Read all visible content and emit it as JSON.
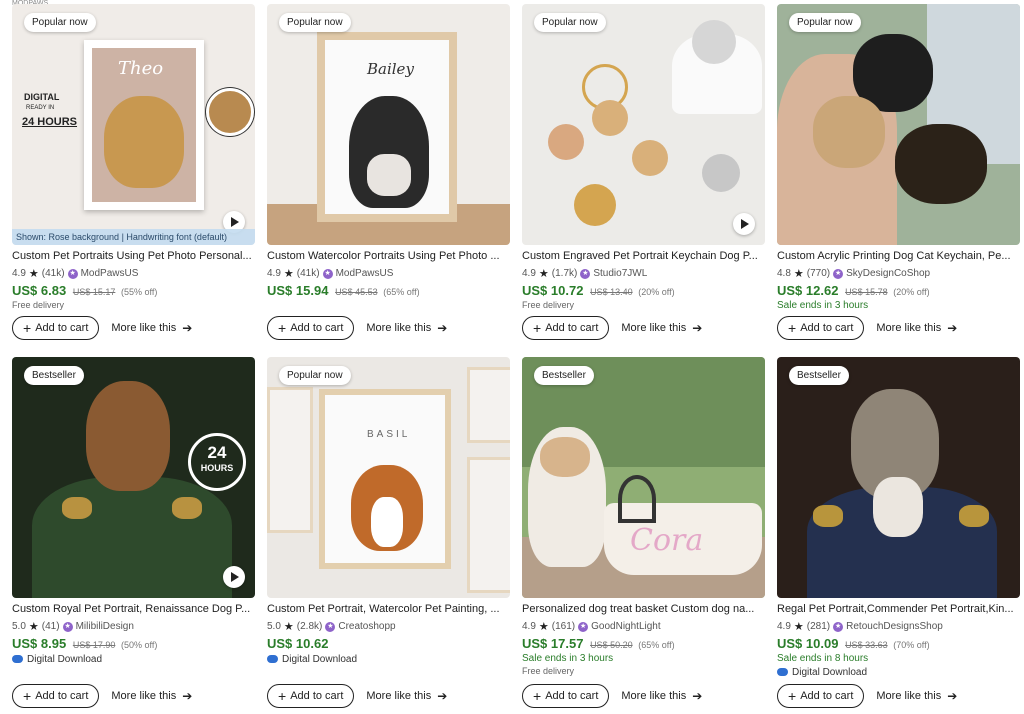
{
  "top_label": "MODPAWS",
  "buttons": {
    "add_to_cart": "Add to cart",
    "more_like_this": "More like this"
  },
  "colors": {
    "price": "#2a7d2a",
    "brand": "#8e63c9"
  },
  "cards": [
    {
      "badge": "Popular now",
      "title": "Custom Pet Portraits Using Pet Photo Personal...",
      "rating": "4.9",
      "reviews": "(41k)",
      "shop": "ModPawsUS",
      "price": "US$ 6.83",
      "old_price": "US$ 15.17",
      "discount": "(55% off)",
      "note": "Free delivery",
      "sale": "",
      "download": "",
      "image_text": {
        "name": "Theo",
        "digital": "DIGITAL",
        "ready": "READY IN",
        "hours": "24 HOURS"
      },
      "caption": "Shown: Rose background | Handwriting font (default)"
    },
    {
      "badge": "Popular now",
      "title": "Custom Watercolor Portraits Using Pet Photo ...",
      "rating": "4.9",
      "reviews": "(41k)",
      "shop": "ModPawsUS",
      "price": "US$ 15.94",
      "old_price": "US$ 45.53",
      "discount": "(65% off)",
      "note": "",
      "sale": "",
      "download": "",
      "image_text": {
        "name": "Bailey"
      }
    },
    {
      "badge": "Popular now",
      "title": "Custom Engraved Pet Portrait Keychain Dog P...",
      "rating": "4.9",
      "reviews": "(1.7k)",
      "shop": "Studio7JWL",
      "price": "US$ 10.72",
      "old_price": "US$ 13.40",
      "discount": "(20% off)",
      "note": "Free delivery",
      "sale": "",
      "download": ""
    },
    {
      "badge": "Popular now",
      "title": "Custom Acrylic Printing Dog Cat Keychain, Pe...",
      "rating": "4.8",
      "reviews": "(770)",
      "shop": "SkyDesignCoShop",
      "price": "US$ 12.62",
      "old_price": "US$ 15.78",
      "discount": "(20% off)",
      "note": "",
      "sale": "Sale ends in 3 hours",
      "download": ""
    },
    {
      "badge": "Bestseller",
      "title": "Custom Royal Pet Portrait, Renaissance Dog P...",
      "rating": "5.0",
      "reviews": "(41)",
      "shop": "MilibiliDesign",
      "price": "US$ 8.95",
      "old_price": "US$ 17.90",
      "discount": "(50% off)",
      "note": "",
      "sale": "",
      "download": "Digital Download",
      "image_text": {
        "hours_num": "24",
        "hours_word": "HOURS"
      }
    },
    {
      "badge": "Popular now",
      "title": "Custom Pet Portrait, Watercolor Pet Painting, ...",
      "rating": "5.0",
      "reviews": "(2.8k)",
      "shop": "Creatoshopp",
      "price": "US$ 10.62",
      "old_price": "",
      "discount": "",
      "note": "",
      "sale": "",
      "download": "Digital Download",
      "image_text": {
        "name": "BASIL"
      }
    },
    {
      "badge": "Bestseller",
      "title": "Personalized dog treat basket Custom dog na...",
      "rating": "4.9",
      "reviews": "(161)",
      "shop": "GoodNightLight",
      "price": "US$ 17.57",
      "old_price": "US$ 50.20",
      "discount": "(65% off)",
      "note": "Free delivery",
      "sale": "Sale ends in 3 hours",
      "download": "",
      "image_text": {
        "name": "Cora"
      }
    },
    {
      "badge": "Bestseller",
      "title": "Regal Pet Portrait,Commender Pet Portrait,Kin...",
      "rating": "4.9",
      "reviews": "(281)",
      "shop": "RetouchDesignsShop",
      "price": "US$ 10.09",
      "old_price": "US$ 33.63",
      "discount": "(70% off)",
      "note": "",
      "sale": "Sale ends in 8 hours",
      "download": "Digital Download"
    }
  ]
}
